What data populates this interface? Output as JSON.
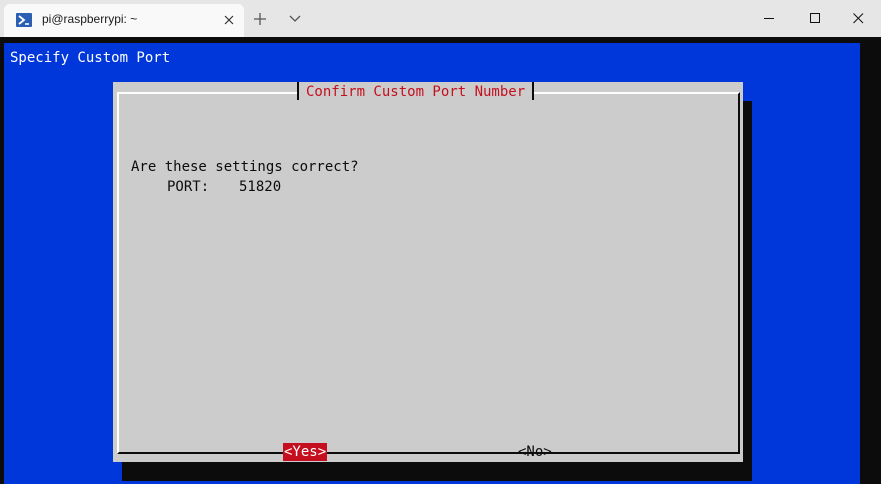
{
  "window": {
    "tab_title": "pi@raspberrypi: ~",
    "tab_icon": "powershell-icon",
    "controls": {
      "new_tab": "plus-icon",
      "dropdown": "chevron-down-icon",
      "minimize": "minimize-icon",
      "maximize": "maximize-icon",
      "close": "close-icon"
    }
  },
  "terminal": {
    "backtitle": "Specify Custom Port",
    "colors": {
      "backdrop": "#0037da",
      "dialog": "#cccccc",
      "accent": "#c50f1f",
      "shadow": "#0c0c0c"
    }
  },
  "dialog": {
    "title": "Confirm Custom Port Number",
    "question": "Are these settings correct?",
    "port_label": "PORT:",
    "port_value": "51820",
    "yes_label": "<Yes>",
    "no_label": "<No>",
    "selected": "<Yes>"
  }
}
